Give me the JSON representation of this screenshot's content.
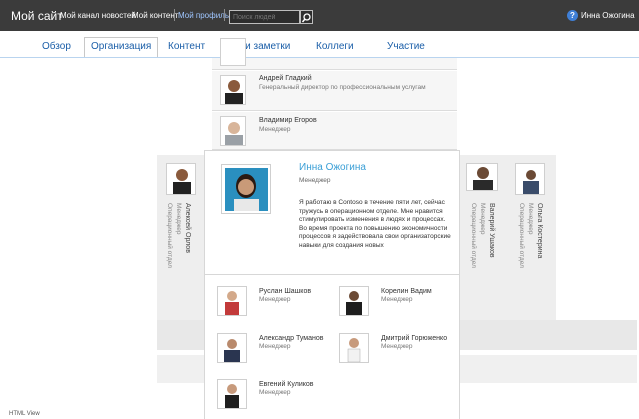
{
  "topbar": {
    "site_title": "Мой сайт",
    "nav_news": "Мой канал новостей",
    "nav_content": "Мой контент",
    "nav_profile": "Мой профиль",
    "search_placeholder": "Поиск людей",
    "user_name": "Инна Ожогина"
  },
  "tabs": [
    "Обзор",
    "Организация",
    "Контент",
    "Теги и заметки",
    "Коллеги",
    "Участие"
  ],
  "managers": [
    {
      "name": "Андрей Гладкий",
      "role": "Генеральный директор по профессиональным услугам"
    },
    {
      "name": "Владимир Егоров",
      "role": "Менеджер"
    }
  ],
  "current": {
    "name": "Инна Ожогина",
    "role": "Менеджер",
    "bio": "Я работаю в Contoso в течение пяти лет, сейчас тружусь в операционном отделе. Мне нравится стимулировать изменения в людях и процессах. Во время проекта по повышению экономичности процессов я задействовала свои организаторские навыки для создания новых"
  },
  "peers_left": [
    {
      "name": "Алексей Орлов",
      "role": "Менеджер",
      "dept": "Операционный отдел"
    }
  ],
  "peers_right": [
    {
      "name": "Валерий Ушаков",
      "role": "Менеджер",
      "dept": "Операционный отдел"
    },
    {
      "name": "Ольга Костерина",
      "role": "Менеджер",
      "dept": "Операционный отдел"
    }
  ],
  "reports": [
    {
      "name": "Руслан Шашков",
      "role": "Менеджер"
    },
    {
      "name": "Корелин Вадим",
      "role": "Менеджер"
    },
    {
      "name": "Александр Туманов",
      "role": "Менеджер"
    },
    {
      "name": "Дмитрий Горюженко",
      "role": "Менеджер"
    },
    {
      "name": "Евгений Куликов",
      "role": "Менеджер"
    }
  ],
  "footer": "HTML View"
}
